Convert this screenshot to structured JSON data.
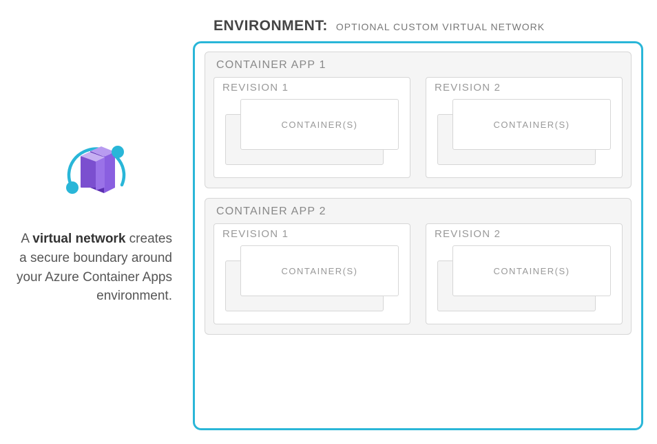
{
  "description": {
    "prefix": "A ",
    "bold": "virtual network",
    "rest": " creates a secure boundary around your Azure Container Apps environment."
  },
  "environment": {
    "label": "ENVIRONMENT:",
    "sublabel": "OPTIONAL CUSTOM VIRTUAL NETWORK"
  },
  "apps": [
    {
      "title": "CONTAINER APP 1",
      "revisions": [
        {
          "title": "REVISION 1",
          "container_label": "CONTAINER(S)"
        },
        {
          "title": "REVISION 2",
          "container_label": "CONTAINER(S)"
        }
      ]
    },
    {
      "title": "CONTAINER APP 2",
      "revisions": [
        {
          "title": "REVISION 1",
          "container_label": "CONTAINER(S)"
        },
        {
          "title": "REVISION 2",
          "container_label": "CONTAINER(S)"
        }
      ]
    }
  ],
  "colors": {
    "environment_border": "#29b6d8",
    "box_border": "#d6d6d6",
    "app_bg": "#f5f5f5",
    "icon_purple": "#7b4fcf",
    "icon_teal": "#29b6d8"
  }
}
